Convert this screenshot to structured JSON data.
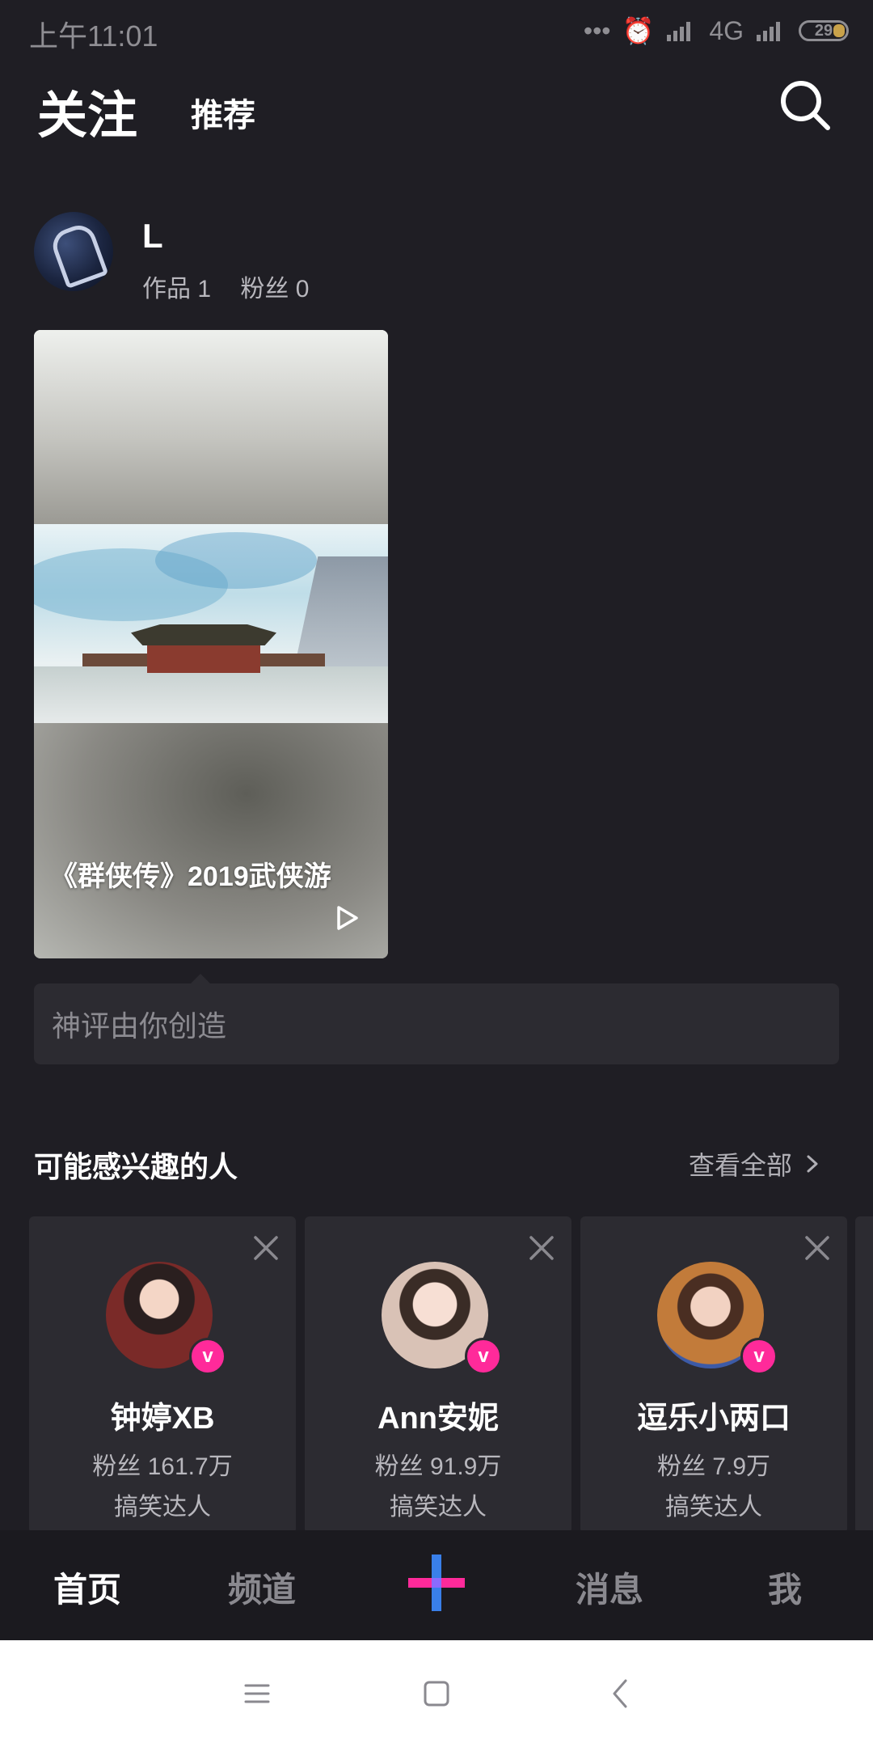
{
  "status_bar": {
    "time": "上午11:01",
    "network": "4G",
    "battery": "29"
  },
  "top_tabs": {
    "follow": "关注",
    "recommend": "推荐"
  },
  "post": {
    "username": "L",
    "works_label": "作品 1",
    "fans_label": "粉丝 0",
    "video_title": "《群侠传》2019武侠游",
    "comment_placeholder": "神评由你创造"
  },
  "suggestions": {
    "title": "可能感兴趣的人",
    "see_all": "查看全部",
    "cards": [
      {
        "name": "钟婷XB",
        "fans": "粉丝 161.7万",
        "tag": "搞笑达人"
      },
      {
        "name": "Ann安妮",
        "fans": "粉丝 91.9万",
        "tag": "搞笑达人"
      },
      {
        "name": "逗乐小两口",
        "fans": "粉丝 7.9万",
        "tag": "搞笑达人"
      }
    ]
  },
  "bottom_nav": {
    "home": "首页",
    "channel": "频道",
    "messages": "消息",
    "me": "我"
  },
  "colors": {
    "background": "#1f1e24",
    "card": "#2c2b31",
    "accent_pink": "#ff2a9a",
    "accent_blue": "#3d8bff"
  }
}
